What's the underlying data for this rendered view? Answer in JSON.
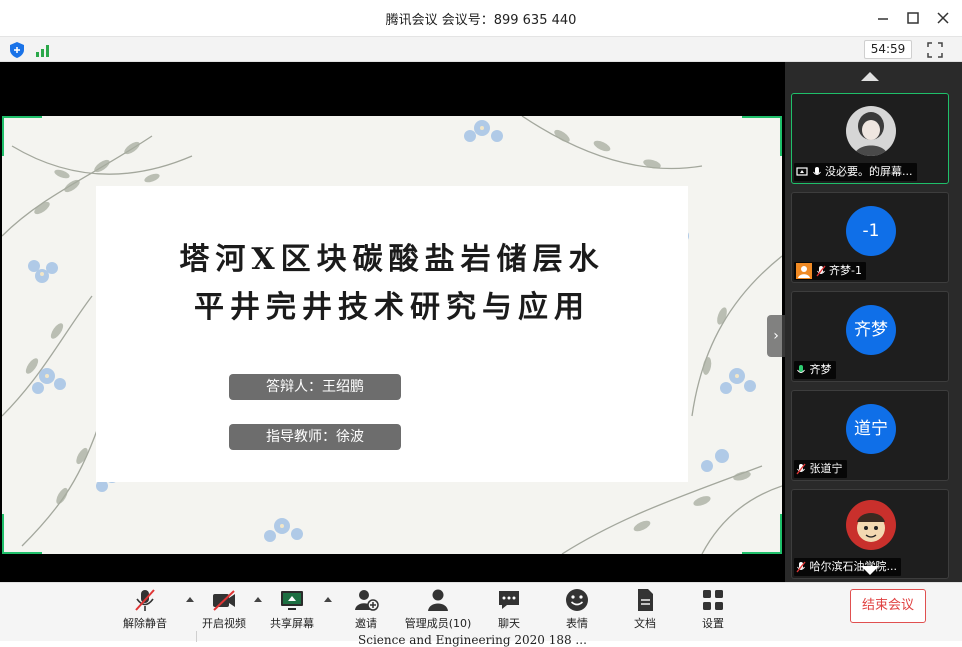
{
  "window": {
    "title": "腾讯会议 会议号：899 635 440"
  },
  "status": {
    "elapsed": "54:59"
  },
  "slide": {
    "title_line1": "塔河X区块碳酸盐岩储层水",
    "title_line2": "平井完井技术研究与应用",
    "presenter": "答辩人：王绍鹏",
    "advisor": "指导教师：徐波"
  },
  "participants": [
    {
      "label": "没必要。的屏幕...",
      "avatar_text": "",
      "mic": "on",
      "sharing": true
    },
    {
      "label": "齐梦-1",
      "avatar_text": "-1",
      "mic": "muted",
      "sharing": false
    },
    {
      "label": "齐梦",
      "avatar_text": "齐梦",
      "mic": "on",
      "sharing": false
    },
    {
      "label": "张道宁",
      "avatar_text": "道宁",
      "mic": "muted",
      "sharing": false
    },
    {
      "label": "哈尔滨石油学院...",
      "avatar_text": "",
      "mic": "muted",
      "sharing": false
    }
  ],
  "toolbar": {
    "unmute": "解除静音",
    "start_video": "开启视频",
    "share_screen": "共享屏幕",
    "invite": "邀请",
    "manage_members": "管理成员(10)",
    "chat": "聊天",
    "reactions": "表情",
    "documents": "文档",
    "settings": "设置",
    "end_meeting": "结束会议"
  },
  "background_text": "Science and Engineering 2020 188 ...",
  "colors": {
    "accent_green": "#1fbf6a",
    "avatar_blue": "#0f6fe8",
    "end_red": "#e04040",
    "pill_gray": "#6d6d6d"
  }
}
